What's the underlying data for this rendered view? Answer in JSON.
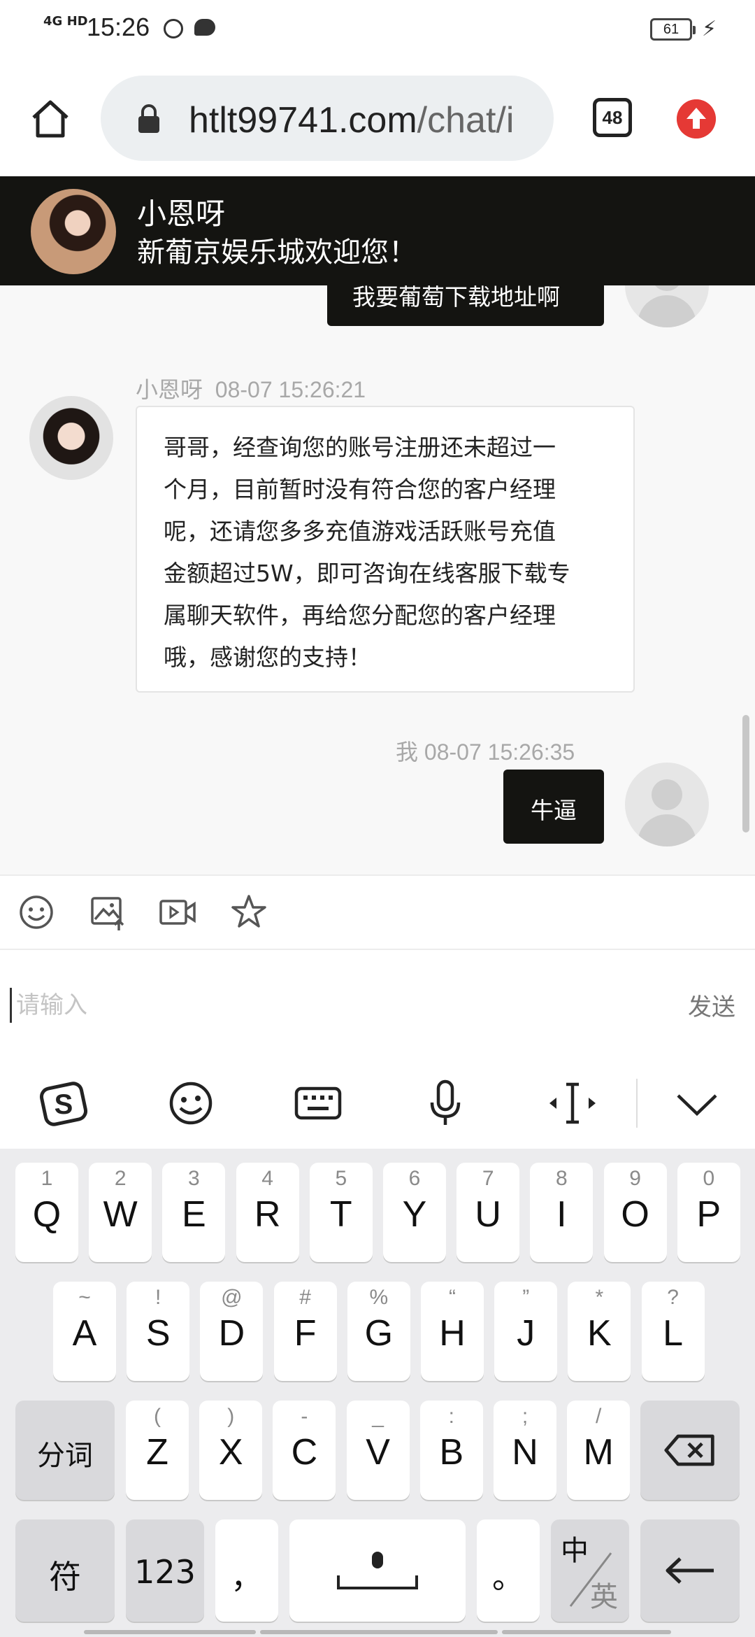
{
  "status_bar": {
    "network": "4G HD",
    "time": "15:26",
    "battery": "61"
  },
  "browser": {
    "url_domain": "htlt99741.com",
    "url_path": "/chat/i",
    "tab_count": "48"
  },
  "chat_header": {
    "name": "小恩呀",
    "welcome": "新葡京娱乐城欢迎您！"
  },
  "messages": [
    {
      "text": "我要葡萄下载地址啊"
    },
    {
      "meta_name": "小恩呀",
      "meta_time": "08-07 15:26:21",
      "lines": [
        "哥哥，经查询您的账号注册还未超过一",
        "个月，目前暂时没有符合您的客户经理",
        "呢，还请您多多充值游戏活跃账号充值",
        "金额超过5W，即可咨询在线客服下载专",
        "属聊天软件，再给您分配您的客户经理",
        "哦，感谢您的支持！"
      ]
    },
    {
      "meta_name": "我",
      "meta_time": "08-07 15:26:35",
      "text": "牛逼"
    }
  ],
  "input": {
    "placeholder": "请输入",
    "send_label": "发送"
  },
  "keyboard": {
    "row1": [
      {
        "hint": "1",
        "key": "Q"
      },
      {
        "hint": "2",
        "key": "W"
      },
      {
        "hint": "3",
        "key": "E"
      },
      {
        "hint": "4",
        "key": "R"
      },
      {
        "hint": "5",
        "key": "T"
      },
      {
        "hint": "6",
        "key": "Y"
      },
      {
        "hint": "7",
        "key": "U"
      },
      {
        "hint": "8",
        "key": "I"
      },
      {
        "hint": "9",
        "key": "O"
      },
      {
        "hint": "0",
        "key": "P"
      }
    ],
    "row2": [
      {
        "hint": "~",
        "key": "A"
      },
      {
        "hint": "!",
        "key": "S"
      },
      {
        "hint": "@",
        "key": "D"
      },
      {
        "hint": "#",
        "key": "F"
      },
      {
        "hint": "%",
        "key": "G"
      },
      {
        "hint": "“",
        "key": "H"
      },
      {
        "hint": "”",
        "key": "J"
      },
      {
        "hint": "*",
        "key": "K"
      },
      {
        "hint": "?",
        "key": "L"
      }
    ],
    "row3": [
      {
        "hint": "(",
        "key": "Z"
      },
      {
        "hint": ")",
        "key": "X"
      },
      {
        "hint": "-",
        "key": "C"
      },
      {
        "hint": "_",
        "key": "V"
      },
      {
        "hint": ":",
        "key": "B"
      },
      {
        "hint": ";",
        "key": "N"
      },
      {
        "hint": "/",
        "key": "M"
      }
    ],
    "segment_label": "分词",
    "symbols_label": "符",
    "numbers_label": "123",
    "comma_label": "，",
    "period_label": "。",
    "lang_top": "中",
    "lang_bottom": "英"
  }
}
